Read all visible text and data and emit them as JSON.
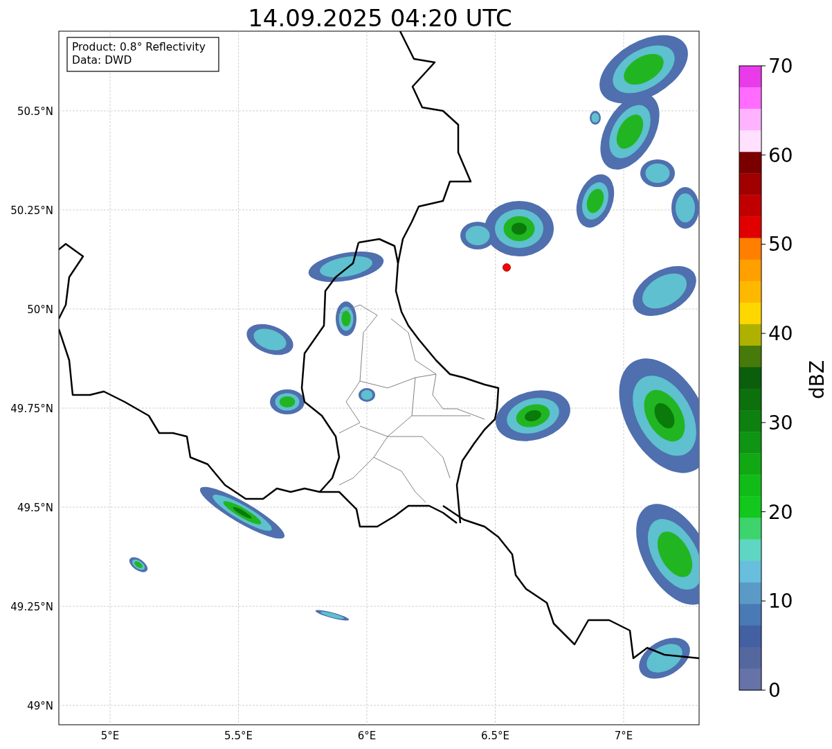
{
  "title": "14.09.2025 04:20 UTC",
  "legend": [
    "Product: 0.8° Reflectivity",
    "Data: DWD"
  ],
  "map": {
    "kind": "map",
    "lat_labels": [
      "50.5°N",
      "50.25°N",
      "50°N",
      "49.75°N",
      "49.5°N",
      "49.25°N",
      "49°N"
    ],
    "lon_labels": [
      "5°E",
      "5.5°E",
      "6°E",
      "6.5°E",
      "7°E"
    ]
  },
  "colorbar": {
    "label": "dBZ",
    "ticks": [
      "70",
      "60",
      "50",
      "40",
      "30",
      "20",
      "10",
      "0"
    ],
    "bands": [
      {
        "color": "#e93be9"
      },
      {
        "color": "#ff6cff"
      },
      {
        "color": "#ffb3ff"
      },
      {
        "color": "#ffe0ff"
      },
      {
        "color": "#7a0000"
      },
      {
        "color": "#a00000"
      },
      {
        "color": "#c00000"
      },
      {
        "color": "#e00000"
      },
      {
        "color": "#ff7f00"
      },
      {
        "color": "#ff9f00"
      },
      {
        "color": "#ffb800"
      },
      {
        "color": "#ffd700"
      },
      {
        "color": "#afb100"
      },
      {
        "color": "#467a0a"
      },
      {
        "color": "#0b5e0b"
      },
      {
        "color": "#0c700c"
      },
      {
        "color": "#0e8010"
      },
      {
        "color": "#0f9413"
      },
      {
        "color": "#11a814"
      },
      {
        "color": "#12bc18"
      },
      {
        "color": "#12c81c"
      },
      {
        "color": "#3dd46e"
      },
      {
        "color": "#5fd6c3"
      },
      {
        "color": "#67bedd"
      },
      {
        "color": "#5b9ac7"
      },
      {
        "color": "#4a7ab5"
      },
      {
        "color": "#4360a3"
      },
      {
        "color": "#55679f"
      },
      {
        "color": "#6673a8"
      }
    ]
  }
}
